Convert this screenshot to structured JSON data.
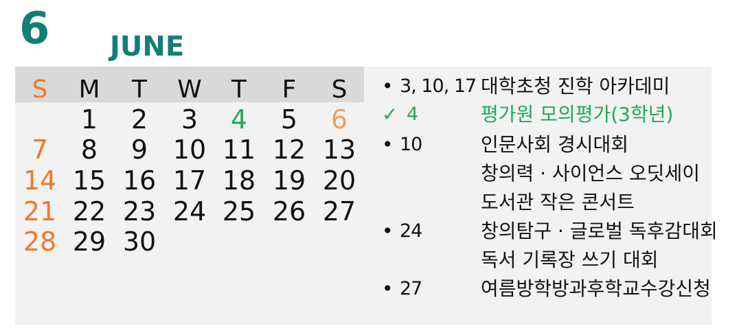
{
  "header": {
    "month_number": "6",
    "month_name": "JUNE"
  },
  "weekdays": [
    "S",
    "M",
    "T",
    "W",
    "T",
    "F",
    "S"
  ],
  "weeks": [
    [
      "",
      "1",
      "2",
      "3",
      "4",
      "5",
      "6"
    ],
    [
      "7",
      "8",
      "9",
      "10",
      "11",
      "12",
      "13"
    ],
    [
      "14",
      "15",
      "16",
      "17",
      "18",
      "19",
      "20"
    ],
    [
      "21",
      "22",
      "23",
      "24",
      "25",
      "26",
      "27"
    ],
    [
      "28",
      "29",
      "30",
      "",
      "",
      "",
      ""
    ]
  ],
  "events": [
    {
      "marker": "•",
      "date": "3, 10, 17",
      "text": "대학초청 진학 아카데미"
    },
    {
      "marker": "✓",
      "date": "4",
      "text": "평가원  모의평가(3학년)"
    },
    {
      "marker": "•",
      "date": "10",
      "text": "인문사회 경시대회"
    },
    {
      "marker": "",
      "date": "",
      "text": "창의력  ·  사이언스 오딧세이"
    },
    {
      "marker": "",
      "date": "",
      "text": "도서관 작은 콘서트"
    },
    {
      "marker": "•",
      "date": "24",
      "text": "창의탐구 · 글로벌 독후감대회"
    },
    {
      "marker": "",
      "date": "",
      "text": "독서 기록장 쓰기 대회"
    },
    {
      "marker": "•",
      "date": "27",
      "text": "여름방학방과후학교수강신청"
    }
  ],
  "colors": {
    "title": "#137e78",
    "sunday": "#f0782a",
    "highlight": "#22a85a",
    "header_bg": "#d9d9d9",
    "panel_bg": "#f2f2f2"
  }
}
